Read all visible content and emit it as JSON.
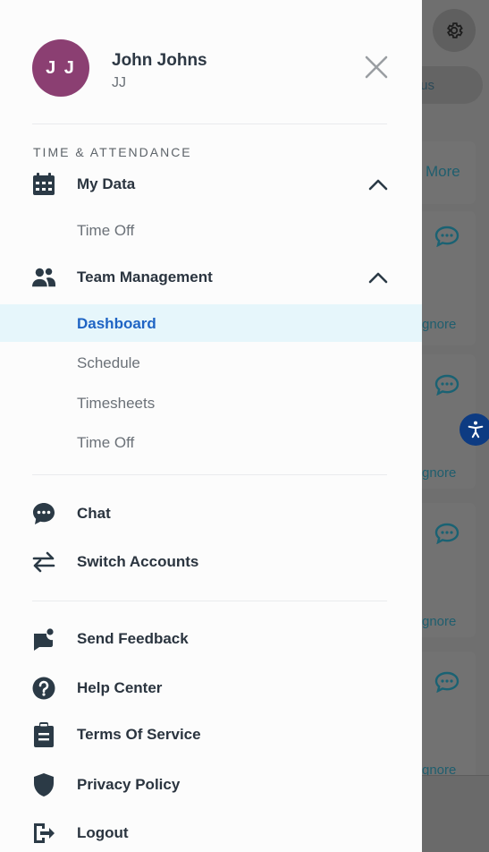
{
  "background": {
    "status_label": "tus",
    "more_label": "More",
    "ignore_label": "gnore"
  },
  "drawer": {
    "avatar_initials": "J J",
    "user_name": "John Johns",
    "user_initials": "JJ",
    "section_title": "TIME & ATTENDANCE",
    "my_data": {
      "label": "My Data",
      "items": [
        "Time Off"
      ]
    },
    "team_management": {
      "label": "Team Management",
      "items": [
        "Dashboard",
        "Schedule",
        "Timesheets",
        "Time Off"
      ],
      "active_item": "Dashboard"
    },
    "chat_label": "Chat",
    "switch_accounts_label": "Switch Accounts",
    "send_feedback_label": "Send Feedback",
    "help_center_label": "Help Center",
    "terms_label": "Terms Of Service",
    "privacy_label": "Privacy Policy",
    "logout_label": "Logout"
  },
  "colors": {
    "avatar_bg": "#8b3f72",
    "active_item_bg": "#e6f6fb",
    "active_item_text": "#1f64c4",
    "icon_dark": "#2b3a46"
  }
}
